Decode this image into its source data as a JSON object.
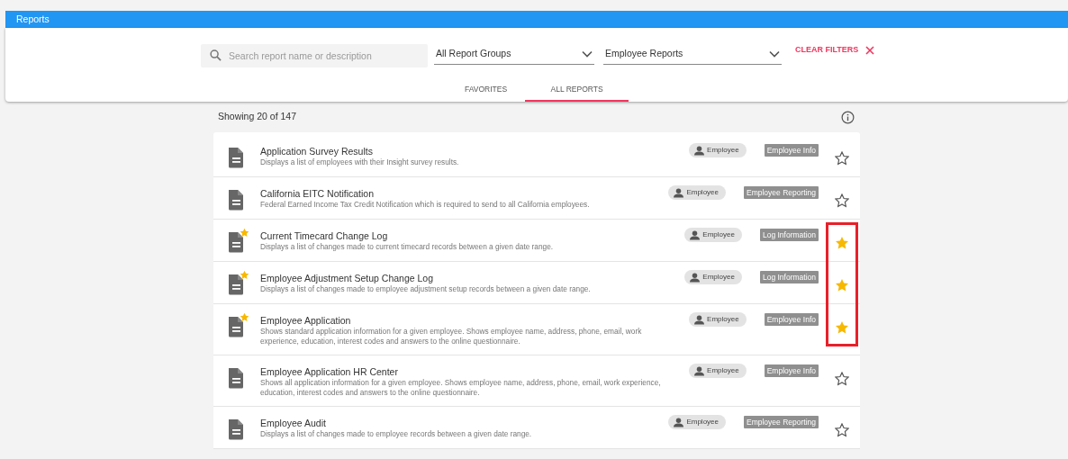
{
  "header": {
    "title": "Reports"
  },
  "filters": {
    "search": {
      "placeholder": "Search report name or description"
    },
    "group_select": {
      "value": "All Report Groups"
    },
    "type_select": {
      "value": "Employee Reports"
    },
    "clear": {
      "label": "CLEAR FILTERS"
    }
  },
  "tabs": [
    {
      "label": "FAVORITES",
      "selected": false
    },
    {
      "label": "ALL REPORTS",
      "selected": true
    }
  ],
  "summary": "Showing 20 of 147",
  "highlight_favorites": true,
  "reports": [
    {
      "title": "Application Survey Results",
      "description": "Displays a list of employees with their Insight survey results.",
      "audience": "Employee",
      "category": "Employee Info",
      "favorite": false
    },
    {
      "title": "California EITC Notification",
      "description": "Federal Earned Income Tax Credit Notification which is required to send to all California employees.",
      "audience": "Employee",
      "category": "Employee Reporting",
      "favorite": false
    },
    {
      "title": "Current Timecard Change Log",
      "description": "Displays a list of changes made to current timecard records between a given date range.",
      "audience": "Employee",
      "category": "Log Information",
      "favorite": true
    },
    {
      "title": "Employee Adjustment Setup Change Log",
      "description": "Displays a list of changes made to employee adjustment setup records between a given date range.",
      "audience": "Employee",
      "category": "Log Information",
      "favorite": true
    },
    {
      "title": "Employee Application",
      "description": "Shows standard application information for a given employee. Shows employee name, address, phone, email, work experience, education, interest codes and answers to the online questionnaire.",
      "audience": "Employee",
      "category": "Employee Info",
      "favorite": true
    },
    {
      "title": "Employee Application HR Center",
      "description": "Shows all application information for a given employee. Shows employee name, address, phone, email, work experience, education, interest codes and answers to the online questionnaire.",
      "audience": "Employee",
      "category": "Employee Info",
      "favorite": false
    },
    {
      "title": "Employee Audit",
      "description": "Displays a list of changes made to employee records between a given date range.",
      "audience": "Employee",
      "category": "Employee Reporting",
      "favorite": false
    }
  ]
}
